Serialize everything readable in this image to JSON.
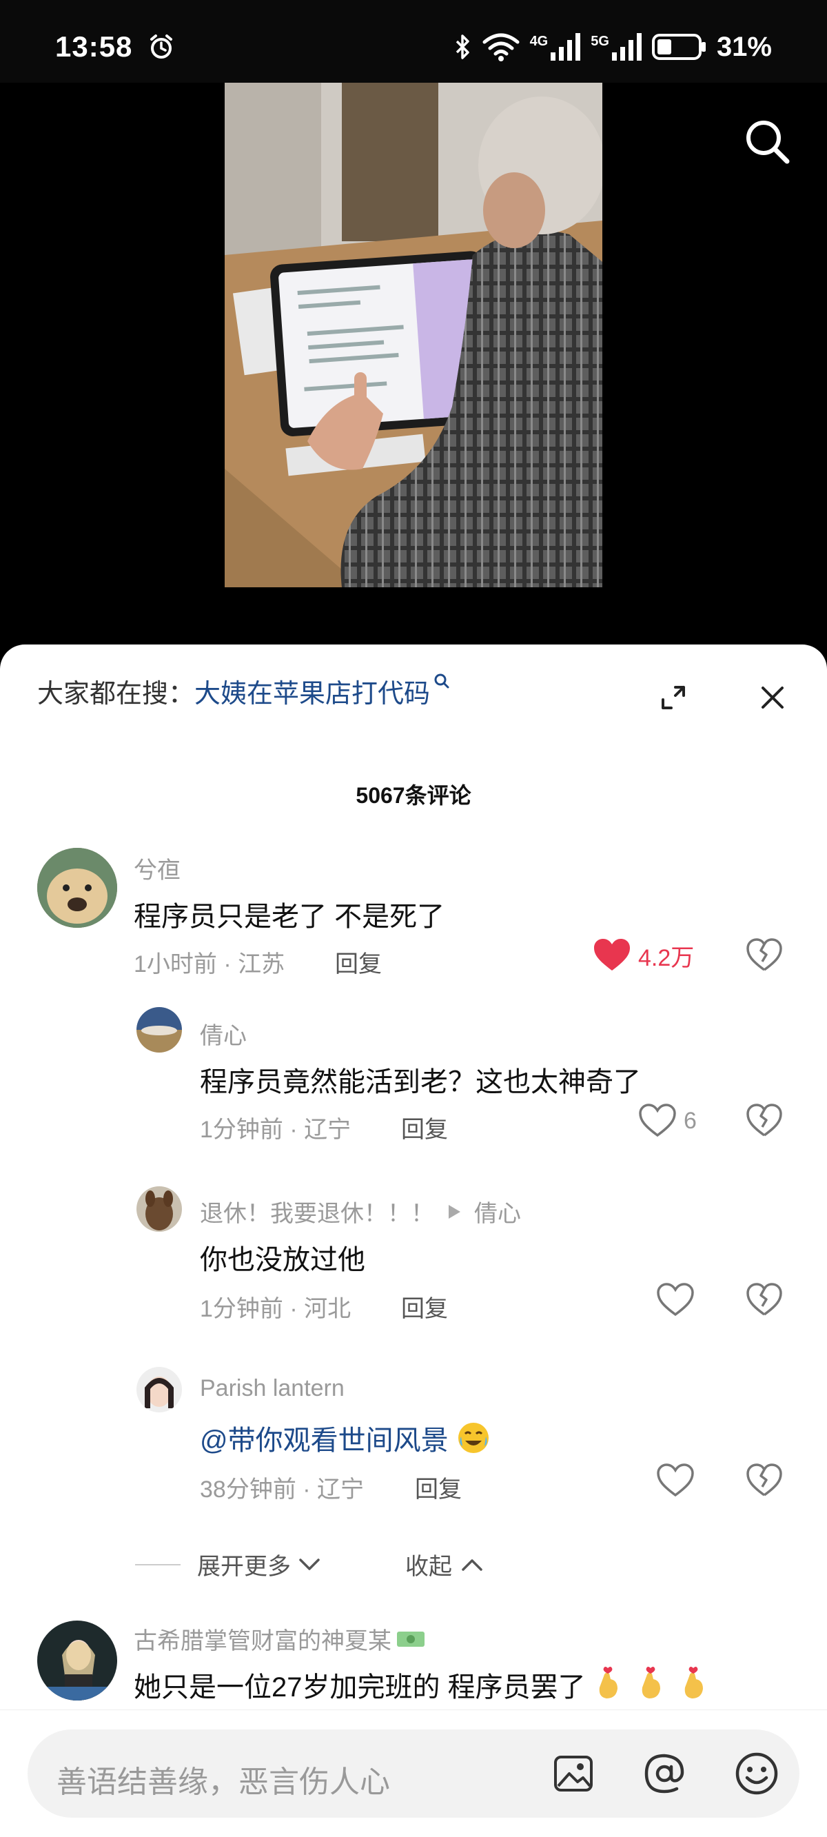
{
  "status_bar": {
    "time": "13:58",
    "network_4g": "4G",
    "network_5g": "5G",
    "battery": "31%",
    "icons": [
      "alarm-icon",
      "bluetooth-icon",
      "wifi-icon",
      "signal-4g-icon",
      "signal-5g-icon",
      "battery-icon"
    ]
  },
  "video": {
    "search_icon": "search-icon"
  },
  "sheet": {
    "trending_prefix": "大家都在搜：",
    "trending_link": "大姨在苹果店打代码",
    "comment_count": "5067条评论",
    "collapse_label": "收起",
    "expand_more_label": "展开更多"
  },
  "comments": [
    {
      "user": "兮亱",
      "text": "程序员只是老了 不是死了",
      "meta": "1小时前 · 江苏",
      "reply_label": "回复",
      "likes": "4.2万",
      "liked": true
    },
    {
      "user": "倩心",
      "text": "程序员竟然能活到老？这也太神奇了",
      "meta": "1分钟前 · 辽宁",
      "reply_label": "回复",
      "likes": "6",
      "liked": false
    },
    {
      "user": "退休！我要退休！！！",
      "reply_to": "倩心",
      "text": "你也没放过他",
      "meta": "1分钟前 · 河北",
      "reply_label": "回复",
      "likes": "",
      "liked": false
    },
    {
      "user": "Parish lantern",
      "text": "@带你观看世间风景",
      "meta": "38分钟前 · 辽宁",
      "reply_label": "回复",
      "likes": "",
      "liked": false
    },
    {
      "user": "古希腊掌管财富的神夏某",
      "text": "她只是一位27岁加完班的 程序员罢了"
    }
  ],
  "input": {
    "placeholder": "善语结善缘，恶言伤人心",
    "icons": [
      "image-icon",
      "at-mention-icon",
      "emoji-icon"
    ]
  },
  "colors": {
    "accent_link": "#1d4a8a",
    "like_red": "#e8364f"
  }
}
